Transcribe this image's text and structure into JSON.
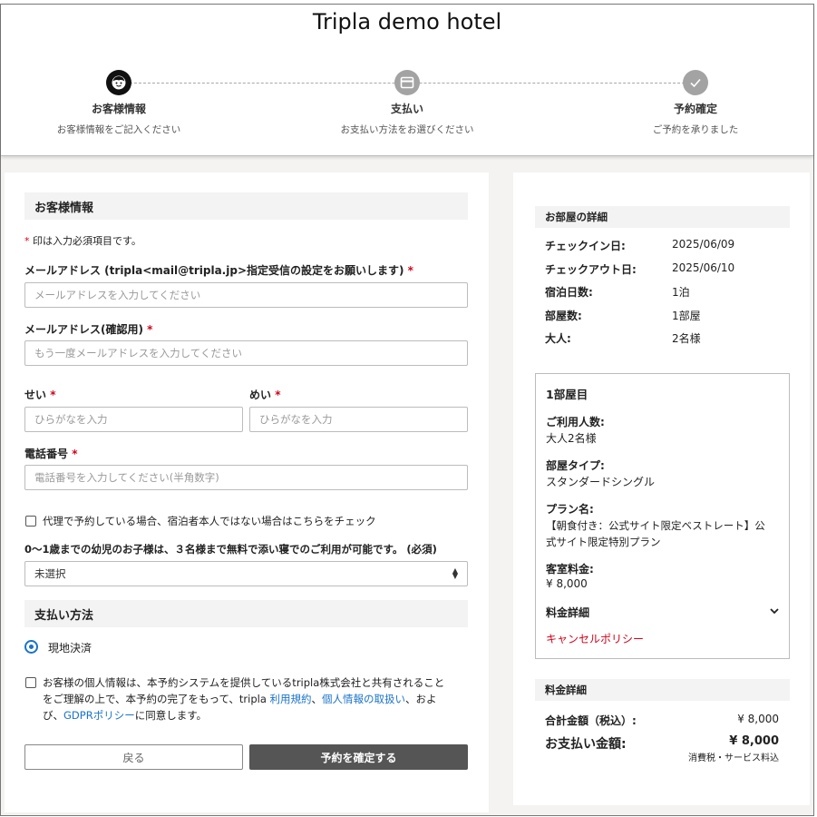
{
  "hotel": {
    "title": "Tripla demo hotel"
  },
  "steps": [
    {
      "name": "お客様情報",
      "desc": "お客様情報をご記入ください",
      "icon": "face-icon",
      "active": true
    },
    {
      "name": "支払い",
      "desc": "お支払い方法をお選びください",
      "icon": "card-icon",
      "active": false
    },
    {
      "name": "予約確定",
      "desc": "ご予約を承りました",
      "icon": "check-icon",
      "active": false
    }
  ],
  "form": {
    "section_title": "お客様情報",
    "required_note": "* 印は入力必須項目です。",
    "email_label": "メールアドレス (tripla<mail@tripla.jp>指定受信の設定をお願いします)",
    "email_placeholder": "メールアドレスを入力してください",
    "email_confirm_label": "メールアドレス(確認用)",
    "email_confirm_placeholder": "もう一度メールアドレスを入力してください",
    "sei_label": "せい",
    "sei_placeholder": "ひらがなを入力",
    "mei_label": "めい",
    "mei_placeholder": "ひらがなを入力",
    "phone_label": "電話番号",
    "phone_placeholder": "電話番号を入力してください(半角数字)",
    "proxy_checkbox_label": "代理で予約している場合、宿泊者本人ではない場合はこちらをチェック",
    "infant_label": "0〜1歳までの幼児のお子様は、３名様まで無料で添い寝でのご利用が可能です。 (必須)",
    "infant_select_value": "未選択",
    "asterisk": "*"
  },
  "payment": {
    "section_title": "支払い方法",
    "option_label": "現地決済"
  },
  "consent": {
    "text_1": "お客様の個人情報は、本予約システムを提供しているtripla株式会社と共有されること",
    "text_2a": "をご理解の上で、本予約の完了をもって、tripla ",
    "link_terms": "利用規約",
    "text_2b": "、",
    "link_privacy": "個人情報の取扱い",
    "text_2c": "、およ",
    "text_3a": "び、",
    "link_gdpr": "GDPRポリシー",
    "text_3b": "に同意します。"
  },
  "buttons": {
    "back": "戻る",
    "confirm": "予約を確定する"
  },
  "room_details": {
    "section_title": "お部屋の詳細",
    "rows": [
      {
        "label": "チェックイン日:",
        "value": "2025/06/09"
      },
      {
        "label": "チェックアウト日:",
        "value": "2025/06/10"
      },
      {
        "label": "宿泊日数:",
        "value": "1泊"
      },
      {
        "label": "部屋数:",
        "value": "1部屋"
      },
      {
        "label": "大人:",
        "value": "2名様"
      }
    ]
  },
  "room1": {
    "title": "1部屋目",
    "guests_label": "ご利用人数:",
    "guests_value": "大人2名様",
    "type_label": "部屋タイプ:",
    "type_value": "スタンダードシングル",
    "plan_label": "プラン名:",
    "plan_value_1": "【朝食付き：公式サイト限定ベストレート】公",
    "plan_value_2": "式サイト限定特別プラン",
    "price_label": "客室料金:",
    "price_value": "¥ 8,000",
    "breakdown_label": "料金詳細",
    "cancel_policy": "キャンセルポリシー"
  },
  "fee": {
    "section_title": "料金詳細",
    "total_label": "合計金額（税込）:",
    "total_value": "¥ 8,000",
    "pay_label": "お支払い金額:",
    "pay_value": "¥ 8,000",
    "tax_note": "消費税・サービス料込"
  },
  "colors": {
    "accent_blue": "#1a73c9",
    "required_red": "#d0021b",
    "confirm_button": "#555555"
  }
}
